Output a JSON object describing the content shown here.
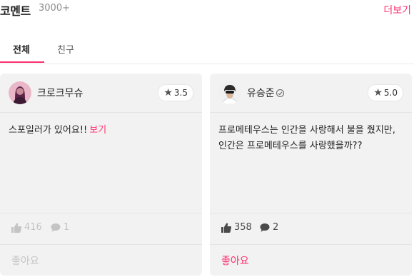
{
  "section": {
    "title": "코멘트",
    "count": "3000+",
    "more_label": "더보기"
  },
  "tabs": [
    {
      "label": "전체",
      "active": true
    },
    {
      "label": "친구",
      "active": false
    }
  ],
  "comments": [
    {
      "user": "크로크무슈",
      "rating": "3.5",
      "text": "스포일러가 있어요!!",
      "spoiler_link": "보기",
      "likes": "416",
      "replies": "1",
      "like_label": "좋아요",
      "like_active": false
    },
    {
      "user": "유승준",
      "rating": "5.0",
      "text": "프로메테우스는 인간을 사랑해서 불을 줬지만, 인간은 프로메테우스를 사랑했을까??",
      "likes": "358",
      "replies": "2",
      "like_label": "좋아요",
      "like_active": true
    }
  ],
  "colors": {
    "accent": "#ff2f6e",
    "card_bg": "#f2f2f2"
  },
  "icons": {
    "rating": "star-icon",
    "likes": "thumbs-up-icon",
    "replies": "speech-bubble-icon",
    "user_badge": "verified-badge-icon"
  }
}
